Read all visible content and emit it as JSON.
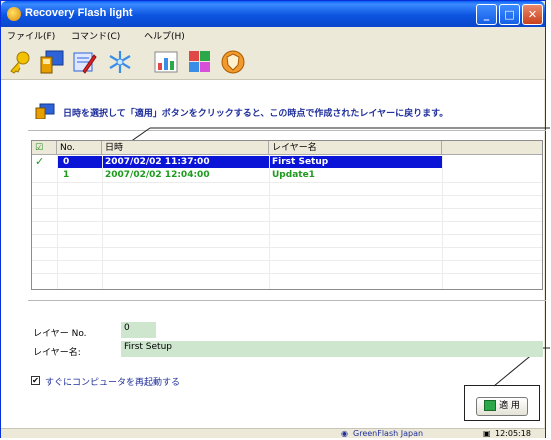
{
  "window": {
    "title": "Recovery Flash light",
    "title_bar_color": "#0a5ef5",
    "controls": {
      "minimize": "_",
      "maximize": "□",
      "close": "✕"
    }
  },
  "menu": {
    "items": [
      {
        "label": "ファイル(F)"
      },
      {
        "label": "コマンド(C)"
      },
      {
        "label": "ヘルプ(H)"
      }
    ]
  },
  "toolbar": {
    "tools": [
      {
        "icon": "key-icon"
      },
      {
        "icon": "monitor-icon"
      },
      {
        "icon": "edit-icon"
      },
      {
        "icon": "snowflake-icon"
      },
      {
        "icon": "chart-icon"
      },
      {
        "icon": "puzzle-icon"
      },
      {
        "icon": "shield-icon"
      }
    ]
  },
  "info": {
    "text": "日時を選択して「適用」ボタンをクリックすると、この時点で作成されたレイヤーに戻ります。"
  },
  "list": {
    "columns": {
      "check": "☑",
      "no": "No.",
      "datetime": "日時",
      "layer": "レイヤー名"
    },
    "rows": [
      {
        "check": "✓",
        "no": "0",
        "datetime": "2007/02/02 11:37:00",
        "layer": "First Setup",
        "selected": true
      },
      {
        "check": "",
        "no": "1",
        "datetime": "2007/02/02 12:04:00",
        "layer": "Update1",
        "selected": false
      }
    ],
    "selected_row_color": "#0a14d6",
    "second_row_color": "#1e9a1e"
  },
  "details": {
    "layer_no_label": "レイヤー No.",
    "layer_no_value": "0",
    "layer_name_label": "レイヤー名:",
    "layer_name_value": "First Setup"
  },
  "options": {
    "restart_label": "すぐにコンピュータを再起動する",
    "restart_checked": true,
    "check_mark": "✔"
  },
  "apply_button": {
    "label": "適 用"
  },
  "statusbar": {
    "tray_text": "GreenFlash Japan",
    "time": "12:05:18"
  }
}
